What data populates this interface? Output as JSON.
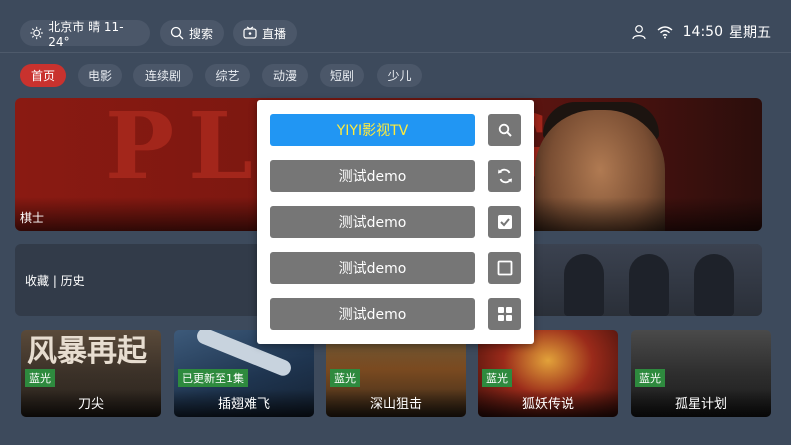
{
  "topbar": {
    "weather": "北京市 晴 11-24°",
    "search": "搜索",
    "live": "直播",
    "time": "14:50",
    "weekday": "星期五"
  },
  "tabs": [
    "首页",
    "电影",
    "连续剧",
    "综艺",
    "动漫",
    "短剧",
    "少儿"
  ],
  "banner": {
    "bg_text": "PLAY GO",
    "title": "棋士"
  },
  "favorites_label": "收藏 | 历史",
  "dialog": {
    "buttons": [
      "YIYI影视TV",
      "测试demo",
      "测试demo",
      "测试demo",
      "测试demo"
    ],
    "icons": [
      "search-icon",
      "refresh-icon",
      "checkbox-checked-icon",
      "checkbox-empty-icon",
      "grid-icon"
    ]
  },
  "posters": [
    {
      "title": "刀尖",
      "badge": "蓝光",
      "poster_text": "风暴再起"
    },
    {
      "title": "插翅难飞",
      "badge": "已更新至1集"
    },
    {
      "title": "深山狙击",
      "badge": "蓝光"
    },
    {
      "title": "狐妖传说",
      "badge": "蓝光"
    },
    {
      "title": "孤星计划",
      "badge": "蓝光"
    }
  ],
  "colors": {
    "background": "#3d4a5c",
    "active_tab": "#c9322e",
    "primary_button": "#2196f3",
    "primary_text": "#ffeb3b",
    "badge": "#2e8a3e"
  }
}
